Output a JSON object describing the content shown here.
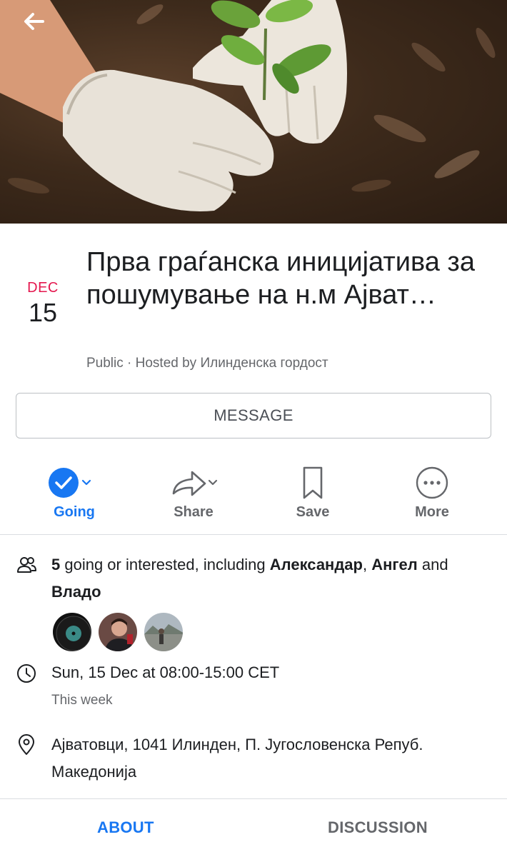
{
  "event": {
    "month": "DEC",
    "day": "15",
    "title": "Прва граѓанска иницијатива за пошумување на н.м Ајват…",
    "subtitle": "Public · Hosted by Илинденска гордост"
  },
  "buttons": {
    "message": "MESSAGE"
  },
  "actions": [
    {
      "label": "Going",
      "icon": "check-circle-icon"
    },
    {
      "label": "Share",
      "icon": "share-arrow-icon"
    },
    {
      "label": "Save",
      "icon": "bookmark-icon"
    },
    {
      "label": "More",
      "icon": "more-dots-icon"
    }
  ],
  "going": {
    "count": "5",
    "text_mid": " going or interested, including ",
    "name1": "Александар",
    "sep": ", ",
    "name2": "Ангел",
    "and": " and ",
    "name3": "Владо"
  },
  "time": {
    "text": "Sun, 15 Dec at 08:00-15:00 CET",
    "sub": "This week"
  },
  "location": {
    "text": "Ајватовци, 1041 Илинден, П. Југословенска Репуб. Македонија"
  },
  "tabs": {
    "about": "ABOUT",
    "discussion": "DISCUSSION"
  },
  "colors": {
    "accent": "#1877f2",
    "date_month": "#e4174e"
  }
}
